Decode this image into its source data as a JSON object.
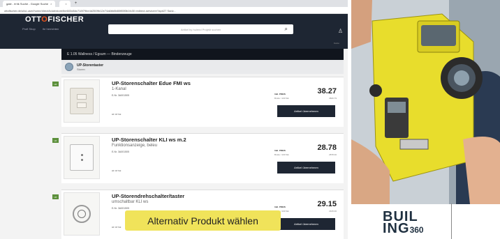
{
  "browser": {
    "tabs": [
      {
        "label": "gate - ♦ ttk Suche - Google Suche",
        "close": "×"
      },
      {
        "label": "",
        "close": "×"
      }
    ],
    "new_tab": "+",
    "address": "ottofischer.de/ui/ui-user/home/direct/kdub/store/ibe603d8dc718f79be4d2509b12e74a6bb8b80f85f3b1fc30 redirect-serviceer?ap#27 Sadv..."
  },
  "header": {
    "logo_left": "OTT",
    "logo_o": "O",
    "logo_right": "FISCHER",
    "nav": [
      "Profi Shop",
      "Ihr herrichten"
    ],
    "search_placeholder": "Artikel by hu/end Projekt suchen",
    "user_label": "Konto"
  },
  "breadcrumb": "E 1.05 Wallness / Egsum — Bindenzeuge",
  "category": {
    "title": "UP-Storentaster",
    "subtitle": "Storen"
  },
  "products": [
    {
      "tag": "HF",
      "name": "UP-Storenschalter Edue FMI ws",
      "desc": "1-Kanal",
      "number": "E-Nr. 3A001505",
      "unit": "HF 18 Stk",
      "stock": "485 auf Lager",
      "price_label": "Inkl. PREIS",
      "price_sub": "Brutto / 100 Stk",
      "price": "38.27",
      "price_small": "3826.79",
      "button": "Artikel übernehmen"
    },
    {
      "tag": "HF",
      "name": "UP-Storenschalter KLI ws m.2",
      "desc": "Funktionsanzeige, beleu",
      "number": "E-Nr. 3A001505",
      "unit": "HF 18 Stk",
      "stock": "285 auf Lager",
      "price_label": "Inkl. PREIS",
      "price_sub": "Brutto / 100 Stk",
      "price": "28.78",
      "price_small": "2878.30",
      "button": "Artikel übernehmen"
    },
    {
      "tag": "HF",
      "name": "UP-Storendrehschalter/taster",
      "desc": "umschaltbar KLI ws",
      "number": "E-Nr. 3A001505",
      "unit": "HF 18 Stk",
      "stock": "Ein 14 Paket verfügbar",
      "price_label": "Inkl. PREIS",
      "price_sub": "Brutto / 100 Stk",
      "price": "29.15",
      "price_small": "2915.00",
      "button": "Artikel übernehmen"
    }
  ],
  "caption": "Alternativ Produkt wählen",
  "brand": {
    "line1": "BUIL",
    "line2": "ING",
    "num": "360"
  },
  "colors": {
    "header": "#1e2633",
    "accent": "#e8541c",
    "caption_bg": "#f0e35a",
    "device": "#e8dd2c"
  }
}
